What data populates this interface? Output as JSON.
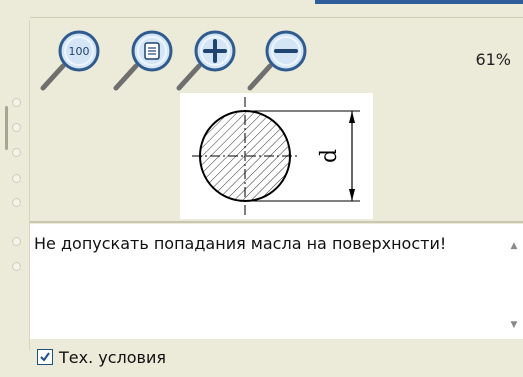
{
  "toolbar": {
    "zoom_100_label": "100",
    "zoom_fit_icon": "fit-page-icon",
    "zoom_in_icon": "zoom-in-icon",
    "zoom_out_icon": "zoom-out-icon",
    "zoom_percent": "61%"
  },
  "drawing": {
    "dimension_label": "d"
  },
  "note": {
    "text": "Не допускать попадания масла на поверхности!"
  },
  "footer": {
    "checkbox_checked": true,
    "checkbox_label": "Тех. условия"
  },
  "colors": {
    "panel_bg": "#ecead8",
    "accent_blue": "#2f5e9c",
    "icon_fill": "#d4e5f6",
    "icon_stroke": "#2f5b8f"
  }
}
